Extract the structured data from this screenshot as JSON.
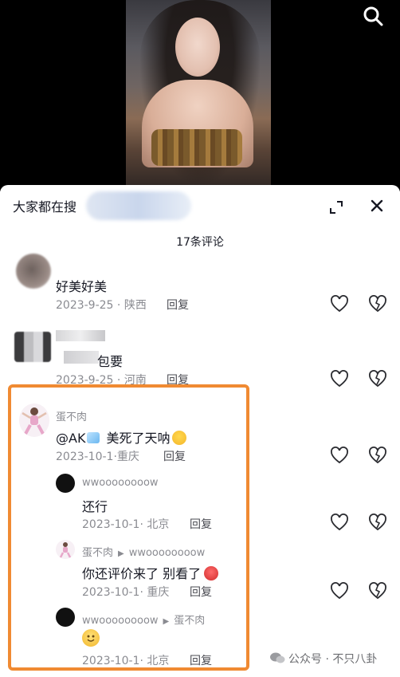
{
  "header": {
    "search_prefix": "大家都在搜"
  },
  "comments_count": "17条评论",
  "comments": [
    {
      "name": "",
      "text": "好美好美",
      "date": "2023-9-25",
      "region": "陕西",
      "reply": "回复"
    },
    {
      "name": "",
      "text": "包要",
      "date": "2023-9-25",
      "region": "河南",
      "reply": "回复"
    },
    {
      "name": "蛋不肉",
      "mention": "@AK",
      "text": "美死了天呐",
      "date": "2023-10-1",
      "region": "重庆",
      "reply": "回复"
    }
  ],
  "replies": [
    {
      "name": "wwoooooooow",
      "to": "",
      "text": "还行",
      "date": "2023-10-1",
      "region": "北京",
      "reply": "回复"
    },
    {
      "name": "蛋不肉",
      "to": "wwoooooooow",
      "text": "你还评价来了 别看了",
      "date": "2023-10-1",
      "region": "重庆",
      "reply": "回复"
    },
    {
      "name": "wwoooooooow",
      "to": "蛋不肉",
      "text": "",
      "date": "2023-10-1",
      "region": "北京",
      "reply": "回复"
    }
  ],
  "watermark": "公众号 · 不只八卦",
  "colors": {
    "highlight": "#f08a32",
    "meta": "#8a8b91"
  }
}
